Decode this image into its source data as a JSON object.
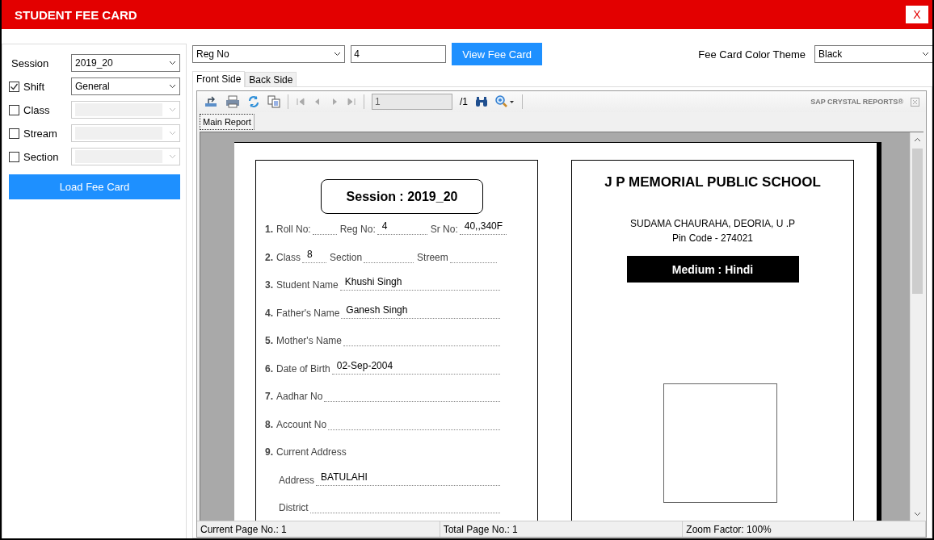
{
  "window": {
    "title": "STUDENT FEE CARD",
    "close": "X"
  },
  "filters": [
    {
      "kind": "plain",
      "label": "Session",
      "value": "2019_20",
      "disabled": false
    },
    {
      "kind": "check",
      "label": "Shift",
      "checked": true,
      "value": "General",
      "disabled": false
    },
    {
      "kind": "check",
      "label": "Class",
      "checked": false,
      "disabled": true
    },
    {
      "kind": "check",
      "label": "Stream",
      "checked": false,
      "disabled": true
    },
    {
      "kind": "check",
      "label": "Section",
      "checked": false,
      "disabled": true
    }
  ],
  "load_button": "Load Fee Card",
  "search": {
    "by": "Reg No",
    "value": "4",
    "button": "View Fee Card"
  },
  "theme": {
    "label": "Fee Card Color Theme",
    "value": "Black"
  },
  "tabs": [
    {
      "label": "Front Side",
      "selected": true
    },
    {
      "label": "Back Side",
      "selected": false
    }
  ],
  "viewer": {
    "page": "1",
    "total": "/1",
    "brand": "SAP CRYSTAL REPORTS®",
    "report_tabs": [
      {
        "label": "Main Report",
        "selected": true
      }
    ]
  },
  "card": {
    "session": "Session : 2019_20",
    "rows": [
      {
        "kind": "field",
        "number": "1.",
        "segments": [
          {
            "label": "Roll No:"
          },
          {
            "label": "Reg No:",
            "value": "4"
          },
          {
            "label": "Sr No:",
            "value": "40,,340F"
          }
        ]
      },
      {
        "kind": "field",
        "number": "2.",
        "segments": [
          {
            "label": "Class",
            "value": "8"
          },
          {
            "label": "Section"
          },
          {
            "label": "Streem"
          }
        ]
      },
      {
        "kind": "field",
        "number": "3.",
        "segments": [
          {
            "label": "Student Name",
            "value": "Khushi Singh"
          }
        ]
      },
      {
        "kind": "field",
        "number": "4.",
        "segments": [
          {
            "label": "Father's Name",
            "value": "Ganesh Singh"
          }
        ]
      },
      {
        "kind": "field",
        "number": "5.",
        "segments": [
          {
            "label": "Mother's Name"
          }
        ]
      },
      {
        "kind": "field",
        "number": "6.",
        "segments": [
          {
            "label": "Date of Birth",
            "value": "02-Sep-2004"
          }
        ]
      },
      {
        "kind": "field",
        "number": "7.",
        "segments": [
          {
            "label": "Aadhar No"
          }
        ]
      },
      {
        "kind": "field",
        "number": "8.",
        "segments": [
          {
            "label": "Account No"
          }
        ]
      },
      {
        "kind": "heading",
        "number": "9.",
        "segments": [
          {
            "label": "Current Address"
          }
        ]
      },
      {
        "kind": "sub",
        "segments": [
          {
            "label": "Address",
            "value": "BATULAHI"
          }
        ]
      },
      {
        "kind": "sub",
        "segments": [
          {
            "label": "District"
          }
        ]
      }
    ]
  },
  "school": {
    "name": "J P MEMORIAL PUBLIC SCHOOL",
    "address": "SUDAMA CHAURAHA, DEORIA, U .P",
    "pin": "Pin Code - 274021",
    "medium": "Medium : Hindi"
  },
  "status_bar": [
    "Current Page No.: 1",
    "Total Page No.: 1",
    "Zoom Factor: 100%"
  ]
}
